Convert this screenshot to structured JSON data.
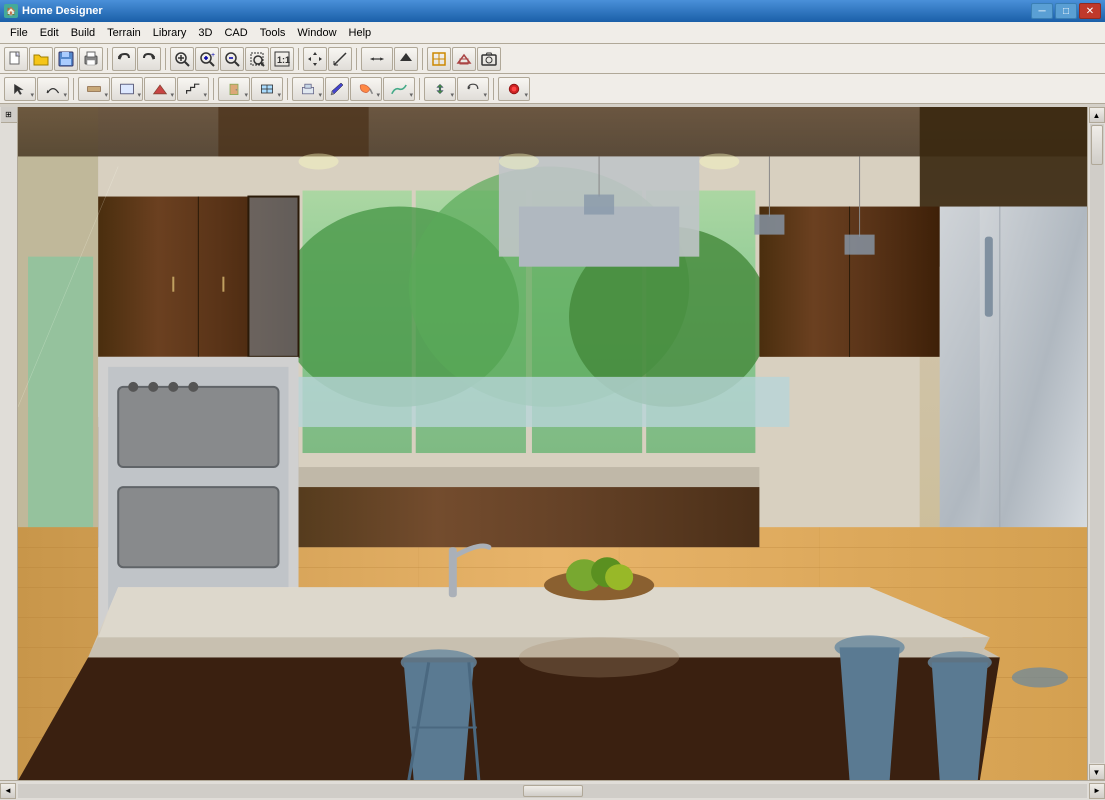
{
  "app": {
    "title": "Home Designer",
    "icon": "🏠"
  },
  "title_bar": {
    "title": "Home Designer",
    "minimize": "─",
    "maximize": "□",
    "close": "✕"
  },
  "menu": {
    "items": [
      "File",
      "Edit",
      "Build",
      "Terrain",
      "Library",
      "3D",
      "CAD",
      "Tools",
      "Window",
      "Help"
    ]
  },
  "toolbar1": {
    "buttons": [
      {
        "name": "new",
        "icon": "📄"
      },
      {
        "name": "open",
        "icon": "📂"
      },
      {
        "name": "save",
        "icon": "💾"
      },
      {
        "name": "print",
        "icon": "🖨"
      },
      {
        "name": "undo",
        "icon": "↩"
      },
      {
        "name": "redo",
        "icon": "↪"
      },
      {
        "name": "zoom-fit",
        "icon": "🔍"
      },
      {
        "name": "zoom-in",
        "icon": "🔍+"
      },
      {
        "name": "zoom-out",
        "icon": "🔍-"
      },
      {
        "name": "zoom-box",
        "icon": "⊞"
      },
      {
        "name": "zoom-real",
        "icon": "⊡"
      },
      {
        "name": "pan",
        "icon": "✋"
      },
      {
        "name": "measure",
        "icon": "📏"
      },
      {
        "name": "mark-moved",
        "icon": "↕"
      },
      {
        "name": "arrows",
        "icon": "↕"
      },
      {
        "name": "select-all",
        "icon": "⬚"
      },
      {
        "name": "help",
        "icon": "?"
      },
      {
        "name": "house-elev",
        "icon": "🏠"
      },
      {
        "name": "house-3d",
        "icon": "🏡"
      },
      {
        "name": "house-cam",
        "icon": "📷"
      }
    ]
  },
  "toolbar2": {
    "buttons": [
      {
        "name": "select",
        "icon": "↖"
      },
      {
        "name": "arc-select",
        "icon": "⌒"
      },
      {
        "name": "walls",
        "icon": "⊟"
      },
      {
        "name": "rooms",
        "icon": "⊞"
      },
      {
        "name": "roof",
        "icon": "⌂"
      },
      {
        "name": "stairs",
        "icon": "≡"
      },
      {
        "name": "door",
        "icon": "🚪"
      },
      {
        "name": "window",
        "icon": "⊞"
      },
      {
        "name": "cabinets",
        "icon": "⊟"
      },
      {
        "name": "fixtures",
        "icon": "✏"
      },
      {
        "name": "paint",
        "icon": "🎨"
      },
      {
        "name": "terrain",
        "icon": "🌄"
      },
      {
        "name": "camera",
        "icon": "📷"
      },
      {
        "name": "move",
        "icon": "✛"
      },
      {
        "name": "transform",
        "icon": "⟲"
      },
      {
        "name": "record",
        "icon": "⏺"
      }
    ]
  },
  "viewport": {
    "scene_type": "3d_kitchen_render"
  },
  "scrollbar": {
    "up": "▲",
    "down": "▼",
    "left": "◄",
    "right": "►"
  }
}
